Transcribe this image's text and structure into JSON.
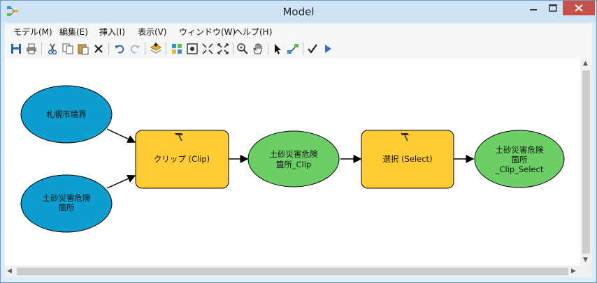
{
  "window": {
    "title": "Model"
  },
  "menu": [
    {
      "label": "モデル(M)"
    },
    {
      "label": "編集(E)"
    },
    {
      "label": "挿入(I)"
    },
    {
      "label": "表示(V)"
    },
    {
      "label": "ウィンドウ(W)"
    },
    {
      "label": "ヘルプ(H)"
    }
  ],
  "toolbar": [
    "save-icon",
    "print-icon",
    "cut-icon",
    "copy-icon",
    "paste-icon",
    "delete-icon",
    "undo-icon",
    "redo-icon",
    "add-data-icon",
    "auto-layout-icon",
    "full-extent-icon",
    "zoom-in-fixed-icon",
    "zoom-out-fixed-icon",
    "zoom-icon",
    "pan-icon",
    "select-icon",
    "connect-icon",
    "validate-icon",
    "run-icon"
  ],
  "colors": {
    "input": "#0d9ecf",
    "tool": "#ffcc33",
    "output": "#6ccf65"
  },
  "nodes": {
    "input1": {
      "lines": [
        "札幌市境界"
      ]
    },
    "input2": {
      "lines": [
        "土砂災害危険",
        "箇所"
      ]
    },
    "tool1": {
      "lines": [
        "クリップ (Clip)"
      ]
    },
    "output1": {
      "lines": [
        "土砂災害危険",
        "箇所_Clip"
      ]
    },
    "tool2": {
      "lines": [
        "選択 (Select)"
      ]
    },
    "output2": {
      "lines": [
        "土砂災害危険",
        "箇所",
        "_Clip_Select"
      ]
    }
  }
}
